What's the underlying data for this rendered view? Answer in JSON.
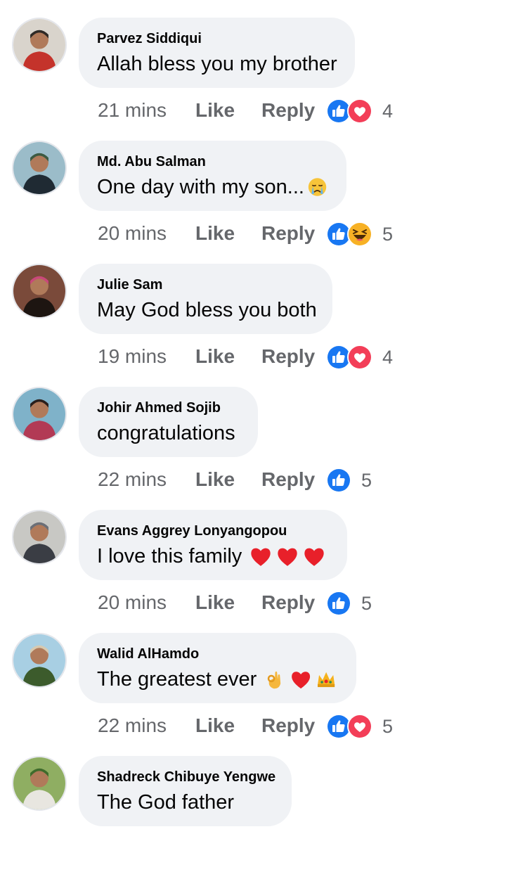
{
  "comments": [
    {
      "author": "Parvez Siddiqui",
      "text": "Allah bless you my brother",
      "text_emoji": [],
      "time": "21 mins",
      "like_label": "Like",
      "reply_label": "Reply",
      "reactions": [
        "like",
        "love"
      ],
      "reaction_count": "4"
    },
    {
      "author": "Md. Abu Salman",
      "text": "One day with my son...",
      "text_emoji": [
        "crying-face"
      ],
      "time": "20 mins",
      "like_label": "Like",
      "reply_label": "Reply",
      "reactions": [
        "like",
        "haha"
      ],
      "reaction_count": "5"
    },
    {
      "author": "Julie Sam",
      "text": "May God bless you both",
      "text_emoji": [],
      "time": "19 mins",
      "like_label": "Like",
      "reply_label": "Reply",
      "reactions": [
        "like",
        "love"
      ],
      "reaction_count": "4"
    },
    {
      "author": "Johir Ahmed Sojib",
      "text": "congratulations",
      "text_emoji": [],
      "time": "22 mins",
      "like_label": "Like",
      "reply_label": "Reply",
      "reactions": [
        "like"
      ],
      "reaction_count": "5"
    },
    {
      "author": "Evans Aggrey Lonyangopou",
      "text": "I love this family",
      "text_emoji": [
        "red-heart",
        "red-heart",
        "red-heart"
      ],
      "time": "20 mins",
      "like_label": "Like",
      "reply_label": "Reply",
      "reactions": [
        "like"
      ],
      "reaction_count": "5"
    },
    {
      "author": "Walid AlHamdo",
      "text": "The greatest ever",
      "text_emoji": [
        "ok-hand",
        "red-heart",
        "crown"
      ],
      "time": "22 mins",
      "like_label": "Like",
      "reply_label": "Reply",
      "reactions": [
        "like",
        "love"
      ],
      "reaction_count": "5"
    },
    {
      "author": "Shadreck Chibuye Yengwe",
      "text": "The God father",
      "text_emoji": [],
      "time": "",
      "like_label": "",
      "reply_label": "",
      "reactions": [],
      "reaction_count": ""
    }
  ],
  "colors": {
    "bubble_bg": "#f0f2f5",
    "meta_text": "#65676b",
    "like_blue": "#1877f2",
    "love_red": "#f33e58",
    "haha_yellow": "#f7b125"
  }
}
